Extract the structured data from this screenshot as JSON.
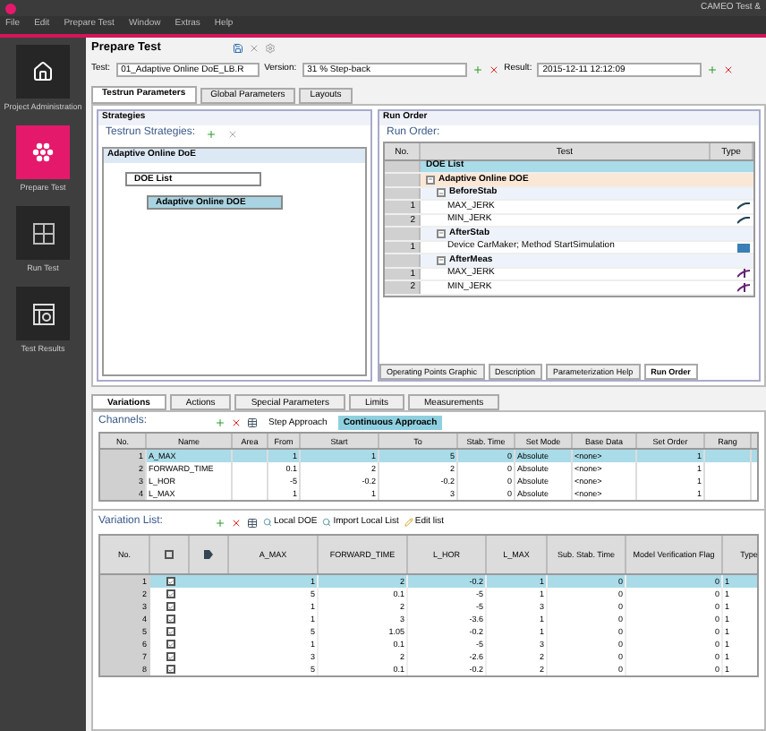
{
  "window": {
    "title": "CAMEO Test &"
  },
  "menu": [
    "File",
    "Edit",
    "Prepare Test",
    "Window",
    "Extras",
    "Help"
  ],
  "sidebar": [
    {
      "label": "Project Administration",
      "kind": "home",
      "selected": false
    },
    {
      "label": "Prepare Test",
      "kind": "prepare",
      "selected": true
    },
    {
      "label": "Run Test",
      "kind": "run",
      "selected": false
    },
    {
      "label": "Test Results",
      "kind": "results",
      "selected": false
    }
  ],
  "header": {
    "title": "Prepare Test"
  },
  "selectors": [
    {
      "label": "Test:",
      "value": "01_Adaptive Online DoE_LB.R"
    },
    {
      "label": "Version:",
      "value": "31 % Step-back"
    },
    {
      "label": "Result:",
      "value": "2015-12-11 12:12:09"
    }
  ],
  "tabs": [
    {
      "label": "Testrun Parameters",
      "selected": true
    },
    {
      "label": "Global Parameters",
      "selected": false
    },
    {
      "label": "Layouts",
      "selected": false
    }
  ],
  "strategies": {
    "title": "Strategies",
    "heading": "Testrun Strategies:",
    "tree_title": "Adaptive Online DoE",
    "nodes": [
      {
        "label": "DOE List",
        "selected": false
      },
      {
        "label": "Adaptive Online DOE",
        "selected": true
      }
    ]
  },
  "run_order": {
    "title": "Run Order",
    "heading": "Run Order:",
    "columns": [
      "No.",
      "Test",
      "Type"
    ],
    "rows": [
      {
        "label": "DOE List",
        "kind": "list",
        "selected": true
      },
      {
        "label": "Adaptive Online DOE",
        "kind": "strategy",
        "selected": false,
        "expanded": true,
        "children": [
          {
            "label": "BeforeStab",
            "kind": "group",
            "selected": false,
            "expanded": true,
            "children": [
              {
                "no": "1",
                "label": "MAX_JERK",
                "kind": "test",
                "selected": false
              },
              {
                "no": "2",
                "label": "MIN_JERK",
                "kind": "test",
                "selected": false
              }
            ]
          },
          {
            "label": "AfterStab",
            "kind": "group",
            "selected": false,
            "expanded": true,
            "children": [
              {
                "no": "1",
                "label": "Device CarMaker; Method StartSimulation",
                "kind": "device",
                "selected": false
              }
            ]
          },
          {
            "label": "AfterMeas",
            "kind": "group",
            "selected": false,
            "expanded": true,
            "children": [
              {
                "no": "1",
                "label": "MAX_JERK",
                "kind": "measure",
                "selected": false
              },
              {
                "no": "2",
                "label": "MIN_JERK",
                "kind": "measure",
                "selected": false
              }
            ]
          }
        ]
      }
    ]
  },
  "bottom_tabs": [
    {
      "label": "Operating Points Graphic",
      "selected": false
    },
    {
      "label": "Description",
      "selected": false
    },
    {
      "label": "Parameterization Help",
      "selected": false
    },
    {
      "label": "Run Order",
      "selected": true
    }
  ],
  "variation_tabs": [
    {
      "label": "Variations",
      "selected": true
    },
    {
      "label": "Actions",
      "selected": false
    },
    {
      "label": "Special Parameters",
      "selected": false
    },
    {
      "label": "Limits",
      "selected": false
    },
    {
      "label": "Measurements",
      "selected": false
    }
  ],
  "channels": {
    "heading": "Channels:",
    "modes": [
      {
        "label": "Step Approach",
        "selected": false
      },
      {
        "label": "Continuous Approach",
        "selected": true
      }
    ],
    "columns": [
      "No.",
      "Name",
      "Area",
      "From",
      "Start",
      "To",
      "Stab. Time",
      "Set Mode",
      "Base Data",
      "Set Order",
      "Rang"
    ],
    "rows": [
      {
        "selected": true,
        "cells": [
          "1",
          "A_MAX",
          "",
          "1",
          "1",
          "5",
          "0",
          "Absolute",
          "<none>",
          "1",
          ""
        ]
      },
      {
        "selected": false,
        "cells": [
          "2",
          "FORWARD_TIME",
          "",
          "0.1",
          "2",
          "2",
          "0",
          "Absolute",
          "<none>",
          "1",
          ""
        ]
      },
      {
        "selected": false,
        "cells": [
          "3",
          "L_HOR",
          "",
          "-5",
          "-0.2",
          "-0.2",
          "0",
          "Absolute",
          "<none>",
          "1",
          ""
        ]
      },
      {
        "selected": false,
        "cells": [
          "4",
          "L_MAX",
          "",
          "1",
          "1",
          "3",
          "0",
          "Absolute",
          "<none>",
          "1",
          ""
        ]
      }
    ]
  },
  "variation_list": {
    "heading": "Variation List:",
    "tools": [
      "Local DOE",
      "Import Local List",
      "Edit list"
    ],
    "columns": [
      {
        "kind": "text",
        "label": "No."
      },
      {
        "kind": "check"
      },
      {
        "kind": "tag"
      },
      {
        "kind": "text",
        "label": "A_MAX"
      },
      {
        "kind": "text",
        "label": "FORWARD_TIME"
      },
      {
        "kind": "text",
        "label": "L_HOR"
      },
      {
        "kind": "text",
        "label": "L_MAX"
      },
      {
        "kind": "text",
        "label": "Sub. Stab. Time"
      },
      {
        "kind": "text",
        "label": "Model Verification Flag"
      },
      {
        "kind": "text",
        "label": "Type"
      }
    ],
    "rows": [
      {
        "no": "1",
        "selected": true,
        "checked": true,
        "values": [
          "1",
          "2",
          "-0.2",
          "1",
          "0",
          "0",
          "1"
        ]
      },
      {
        "no": "2",
        "selected": false,
        "checked": true,
        "values": [
          "5",
          "0.1",
          "-5",
          "1",
          "0",
          "0",
          "1"
        ]
      },
      {
        "no": "3",
        "selected": false,
        "checked": true,
        "values": [
          "1",
          "2",
          "-5",
          "3",
          "0",
          "0",
          "1"
        ]
      },
      {
        "no": "4",
        "selected": false,
        "checked": true,
        "values": [
          "1",
          "3",
          "-3.6",
          "1",
          "0",
          "0",
          "1"
        ]
      },
      {
        "no": "5",
        "selected": false,
        "checked": true,
        "values": [
          "5",
          "1.05",
          "-0.2",
          "1",
          "0",
          "0",
          "1"
        ]
      },
      {
        "no": "6",
        "selected": false,
        "checked": true,
        "values": [
          "1",
          "0.1",
          "-5",
          "3",
          "0",
          "0",
          "1"
        ]
      },
      {
        "no": "7",
        "selected": false,
        "checked": true,
        "values": [
          "3",
          "2",
          "-2.6",
          "2",
          "0",
          "0",
          "1"
        ]
      },
      {
        "no": "8",
        "selected": false,
        "checked": true,
        "values": [
          "5",
          "0.1",
          "-0.2",
          "2",
          "0",
          "0",
          "1"
        ]
      }
    ]
  }
}
